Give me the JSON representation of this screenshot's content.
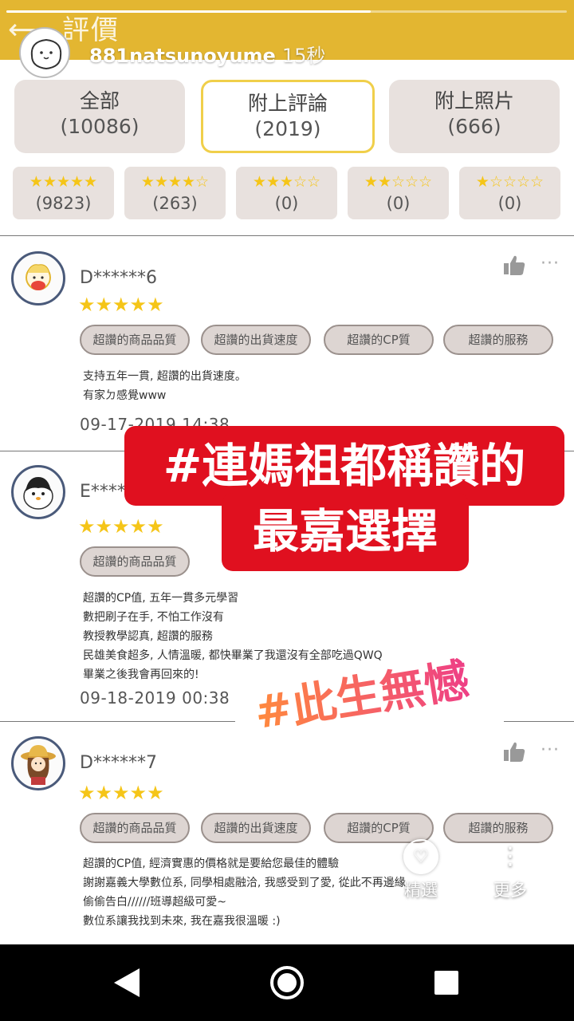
{
  "header": {
    "title": "評價",
    "back_icon": "arrow-left-icon",
    "progress": 0.65
  },
  "story": {
    "username": "881natsunoyume",
    "time": "15秒"
  },
  "tabs": [
    {
      "label": "全部",
      "count": "(10086)",
      "selected": false
    },
    {
      "label": "附上評論",
      "count": "(2019)",
      "selected": true
    },
    {
      "label": "附上照片",
      "count": "(666)",
      "selected": false
    }
  ],
  "star_filters": [
    {
      "stars": 5,
      "count": "(9823)"
    },
    {
      "stars": 4,
      "count": "(263)"
    },
    {
      "stars": 3,
      "count": "(0)"
    },
    {
      "stars": 2,
      "count": "(0)"
    },
    {
      "stars": 1,
      "count": "(0)"
    }
  ],
  "reviews": [
    {
      "name": "D******6",
      "rating": 5,
      "tags": [
        "超讚的商品品質",
        "超讚的出貨速度",
        "超讚的CP質",
        "超讚的服務"
      ],
      "text": "支持五年一貫, 超讚的出貨速度。\n有家ㄉ感覺www",
      "date": "09-17-2019 14:38"
    },
    {
      "name": "E*****",
      "rating": 5,
      "tags": [
        "超讚的商品品質"
      ],
      "text": "超讚的CP值, 五年一貫多元學習\n數把刷子在手, 不怕工作沒有\n教授教學認真, 超讚的服務\n民雄美食超多, 人情溫暖, 都快畢業了我還沒有全部吃過QWQ\n畢業之後我會再回來的!",
      "date": "09-18-2019 00:38"
    },
    {
      "name": "D******7",
      "rating": 5,
      "tags": [
        "超讚的商品品質",
        "超讚的出貨速度",
        "超讚的CP質",
        "超讚的服務"
      ],
      "text": "超讚的CP值, 經濟實惠的價格就是要給您最佳的體驗\n謝謝嘉義大學數位系, 同學相處融洽, 我感受到了愛, 從此不再邊緣\n偷偷告白//////班導超級可愛~\n數位系讓我找到未來, 我在嘉我很溫暖 :)"
    }
  ],
  "stickers": {
    "line1": "#連媽祖都稱讚的",
    "line2": "最嘉選擇",
    "tag": "#此生無憾"
  },
  "actions": {
    "highlight_label": "精選",
    "more_label": "更多"
  },
  "colors": {
    "header": "#e3b631",
    "star": "#f5c518",
    "sticker_red": "#e0101f"
  }
}
